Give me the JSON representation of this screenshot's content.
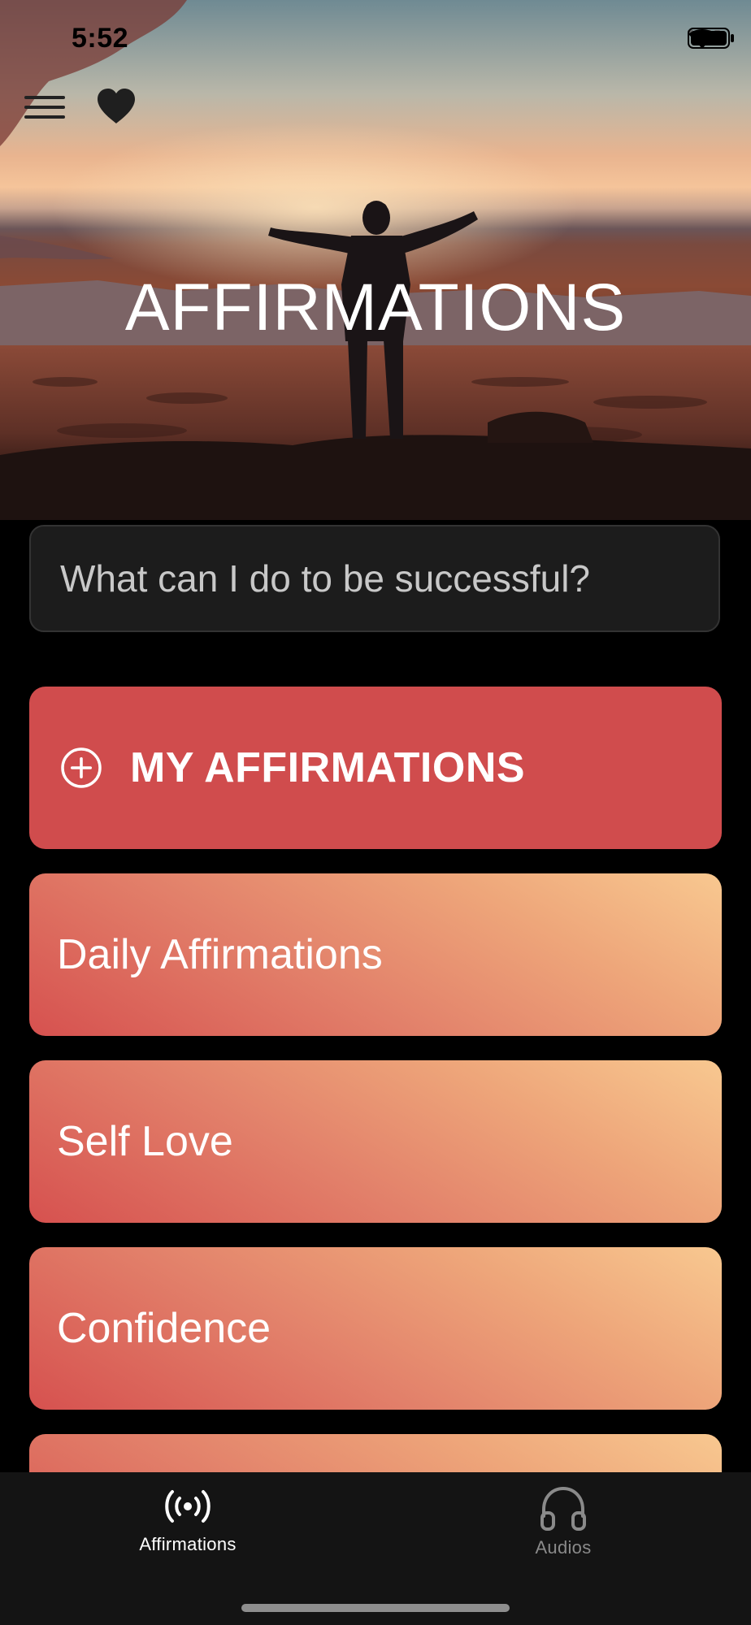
{
  "status_bar": {
    "time": "5:52"
  },
  "header": {
    "title": "AFFIRMATIONS",
    "menu_icon": "hamburger-menu-icon",
    "favorites_icon": "heart-icon"
  },
  "search": {
    "placeholder": "What can I do to be successful?"
  },
  "my_affirmations": {
    "label": "MY AFFIRMATIONS",
    "icon": "plus-circle-icon"
  },
  "categories": [
    {
      "label": "Daily Affirmations"
    },
    {
      "label": "Self Love"
    },
    {
      "label": "Confidence"
    },
    {
      "label": ""
    }
  ],
  "tabs": [
    {
      "label": "Affirmations",
      "icon": "broadcast-icon",
      "active": true
    },
    {
      "label": "Audios",
      "icon": "headphones-icon",
      "active": false
    }
  ],
  "colors": {
    "my_affirmations_bg": "#d04c4d",
    "card_gradient_start": "#d6514f",
    "card_gradient_end": "#f8c890",
    "tab_active": "#ffffff",
    "tab_inactive": "#8a8a8a"
  }
}
